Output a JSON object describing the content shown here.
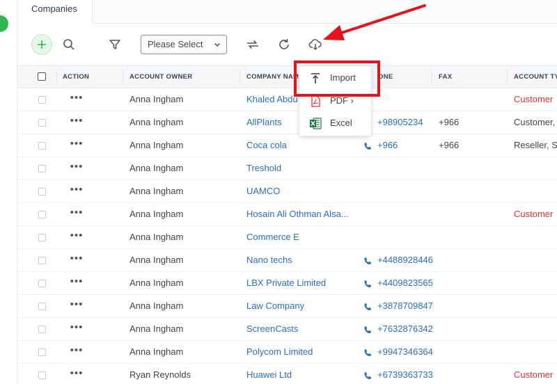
{
  "tabs": [
    {
      "label": "Companies"
    }
  ],
  "toolbar": {
    "select_value": "Please Select"
  },
  "table": {
    "headers": {
      "action": "ACTION",
      "account_owner": "ACCOUNT OWNER",
      "company_name": "COMPANY NAM",
      "phone": "ONE",
      "fax": "FAX",
      "account_type": "ACCOUNT TY"
    },
    "rows": [
      {
        "owner": "Anna Ingham",
        "company": "Khaled Abdu",
        "phone": "",
        "fax": "",
        "type": "Customer",
        "type_red": true
      },
      {
        "owner": "Anna Ingham",
        "company": "AllPlants",
        "phone": "+98905234",
        "fax": "+966",
        "type": "Customer,",
        "type_red": false
      },
      {
        "owner": "Anna Ingham",
        "company": "Coca cola",
        "phone": "+966",
        "fax": "+966",
        "type": "Reseller, S",
        "type_red": false
      },
      {
        "owner": "Anna Ingham",
        "company": "Treshold",
        "phone": "",
        "fax": "",
        "type": "",
        "type_red": false
      },
      {
        "owner": "Anna Ingham",
        "company": "UAMCO",
        "phone": "",
        "fax": "",
        "type": "",
        "type_red": false
      },
      {
        "owner": "Anna Ingham",
        "company": "Hosain Ali Othman Alsa...",
        "phone": "",
        "fax": "",
        "type": "Customer",
        "type_red": true
      },
      {
        "owner": "Anna Ingham",
        "company": "Commerce E",
        "phone": "",
        "fax": "",
        "type": "",
        "type_red": false
      },
      {
        "owner": "Anna Ingham",
        "company": "Nano techs",
        "phone": "+4488928446",
        "fax": "",
        "type": "",
        "type_red": false
      },
      {
        "owner": "Anna Ingham",
        "company": "LBX Private Limited",
        "phone": "+4409823565",
        "fax": "",
        "type": "",
        "type_red": false
      },
      {
        "owner": "Anna Ingham",
        "company": "Law Company",
        "phone": "+3878709847",
        "fax": "",
        "type": "",
        "type_red": false
      },
      {
        "owner": "Anna Ingham",
        "company": "ScreenCasts",
        "phone": "+7632876342",
        "fax": "",
        "type": "",
        "type_red": false
      },
      {
        "owner": "Anna Ingham",
        "company": "Polycom Limited",
        "phone": "+9947346364",
        "fax": "",
        "type": "",
        "type_red": false
      },
      {
        "owner": "Ryan Reynolds",
        "company": "Huawei Ltd",
        "phone": "+6739363733",
        "fax": "",
        "type": "Customer",
        "type_red": true
      }
    ],
    "action_glyph": "•••"
  },
  "export_menu": {
    "items": [
      {
        "label": "Import",
        "icon": "upload-icon"
      },
      {
        "label": "PDF ›",
        "icon": "pdf-icon"
      },
      {
        "label": "Excel",
        "icon": "excel-icon"
      }
    ]
  },
  "colors": {
    "link": "#2b6cc4",
    "accent_green": "#2fb84f",
    "annotation_red": "#e5141b",
    "status_red": "#e03131"
  }
}
